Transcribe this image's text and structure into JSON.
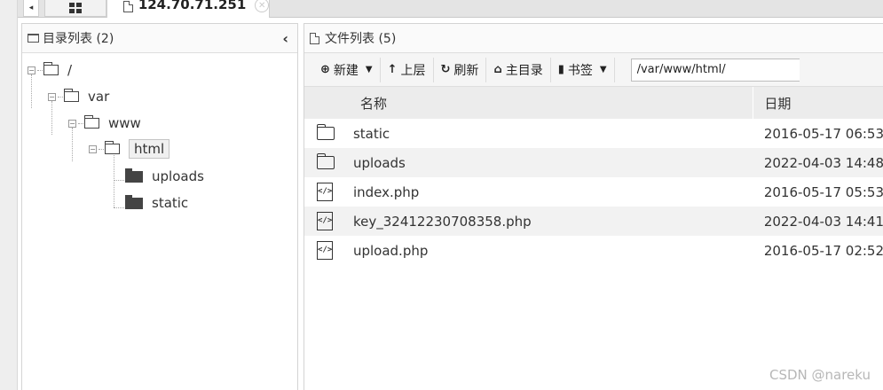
{
  "tabs": {
    "arrow": "◂",
    "active_ip": "124.70.71.251",
    "close": "✕"
  },
  "left_panel": {
    "title": "目录列表 (2)",
    "collapse": "‹",
    "tree": {
      "root": "/",
      "var": "var",
      "www": "www",
      "html": "html",
      "uploads": "uploads",
      "static": "static"
    }
  },
  "right_panel": {
    "title": "文件列表 (5)",
    "toolbar": {
      "new": "新建",
      "up": "上层",
      "refresh": "刷新",
      "home": "主目录",
      "bookmark": "书签",
      "path": "/var/www/html/"
    },
    "columns": {
      "name": "名称",
      "date": "日期"
    },
    "files": [
      {
        "name": "static",
        "date": "2016-05-17 06:53",
        "type": "folder"
      },
      {
        "name": "uploads",
        "date": "2022-04-03 14:48",
        "type": "folder"
      },
      {
        "name": "index.php",
        "date": "2016-05-17 05:53",
        "type": "code"
      },
      {
        "name": "key_32412230708358.php",
        "date": "2022-04-03 14:41",
        "type": "code"
      },
      {
        "name": "upload.php",
        "date": "2016-05-17 02:52",
        "type": "code"
      }
    ]
  },
  "watermark": "CSDN @nareku",
  "icons": {
    "grid": "grid-icon",
    "folder": "folder-icon",
    "file_code": "file-code-icon"
  }
}
